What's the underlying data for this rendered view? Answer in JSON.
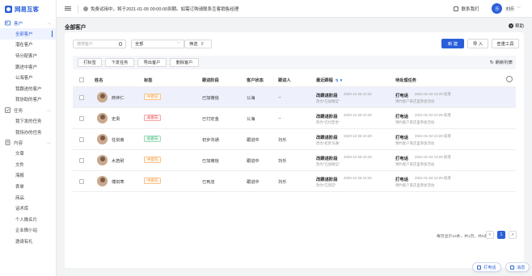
{
  "app": {
    "logo_text": "网易互客"
  },
  "topbar": {
    "notice": "免费试用中，将于2021-01-05 00:00:00到期。如需订购请联系互客销售经理",
    "contact": "联系我们",
    "avatar_text": "乐",
    "user_name": "刘乐"
  },
  "sidebar": {
    "groups": [
      {
        "label": "客户",
        "items": [
          "全部客户",
          "潜在客户",
          "待分配客户",
          "跟进中客户",
          "公海客户",
          "我跟进的客户",
          "我协助的客户"
        ]
      },
      {
        "label": "任务",
        "items": [
          "我下发的任务",
          "我待办的任务"
        ]
      },
      {
        "label": "内容",
        "items": [
          "文章",
          "文件",
          "海报",
          "表单",
          "商品",
          "话术库",
          "个人微名片",
          "企业微小站",
          "邀请有礼"
        ]
      }
    ]
  },
  "page": {
    "title": "全部客户",
    "help": "帮助"
  },
  "toolbar": {
    "search_placeholder": "搜搜客户",
    "select_value": "全部",
    "filter_label": "筛选",
    "new_label": "新 建",
    "import_label": "导 入",
    "query_tool_label": "查重工具"
  },
  "actions": {
    "tag": "打标签",
    "assign": "下发任务",
    "export": "导出客户",
    "delete": "删除客户",
    "refresh": "刷新列表"
  },
  "table": {
    "headers": {
      "name": "姓名",
      "tag": "标签",
      "stage": "跟进阶段",
      "status": "客户状态",
      "follower": "跟进人",
      "latest": "最近跟程",
      "todo": "待处理任务"
    },
    "rows": [
      {
        "name": "商仲仁",
        "tag": "中意向",
        "stage": "已加微信",
        "status": "公海",
        "follower": "--",
        "latest_title": "改跟进阶段",
        "latest_time": "2020-12-28 10:32",
        "latest_sub": "改为“已加微信”",
        "task_title": "打电话",
        "task_time": "2021-01-04 10:29 就增",
        "task_sub": "预约客户来店里参加活动"
      },
      {
        "name": "史贵",
        "tag": "高意向",
        "stage": "已付定金",
        "status": "公海",
        "follower": "--",
        "latest_title": "改跟进阶段",
        "latest_time": "2020-12-28 10:29",
        "latest_sub": "改为“已付定金”",
        "task_title": "打电话",
        "task_time": "2021-01-04 10:29 就增",
        "task_sub": "预约客户来店里参加活动"
      },
      {
        "name": "任剑南",
        "tag": "低意向",
        "stage": "初步沟通",
        "status": "跟进中",
        "follower": "刘乐",
        "latest_title": "改跟进阶段",
        "latest_time": "2020-12-28 10:29",
        "latest_sub": "改为“初步沟通”",
        "task_title": "打电话",
        "task_time": "2021-01-04 10:29 就增",
        "task_sub": "预约客户来店里参加活动"
      },
      {
        "name": "水若耐",
        "tag": "中意向",
        "stage": "已加微信",
        "status": "跟进中",
        "follower": "刘乐",
        "latest_title": "改跟进阶段",
        "latest_time": "2020-12-28 10:29",
        "latest_sub": "改为“已加微信”",
        "task_title": "打电话",
        "task_time": "2021-01-04 10:29 就增",
        "task_sub": "预约客户来店里参加活动"
      },
      {
        "name": "傅剑寒",
        "tag": "中意向",
        "stage": "已到店",
        "status": "跟进中",
        "follower": "刘乐",
        "latest_title": "改跟进阶段",
        "latest_time": "2020-12-28 10:29",
        "latest_sub": "改为“已到店”",
        "task_title": "打电话",
        "task_time": "2021-01-04 10:29 就增",
        "task_sub": "预约客户来店里参加活动"
      }
    ]
  },
  "pagination": {
    "summary": "每页显示10条，共1页，共5条",
    "prev": "<",
    "current": "1",
    "next": ">"
  },
  "floating": {
    "call": "打电话",
    "message": "消息"
  },
  "colors": {
    "primary": "#2b5fd9",
    "tag_mid": "#f29a38",
    "tag_high": "#e5484d",
    "tag_low": "#2fb36b"
  }
}
